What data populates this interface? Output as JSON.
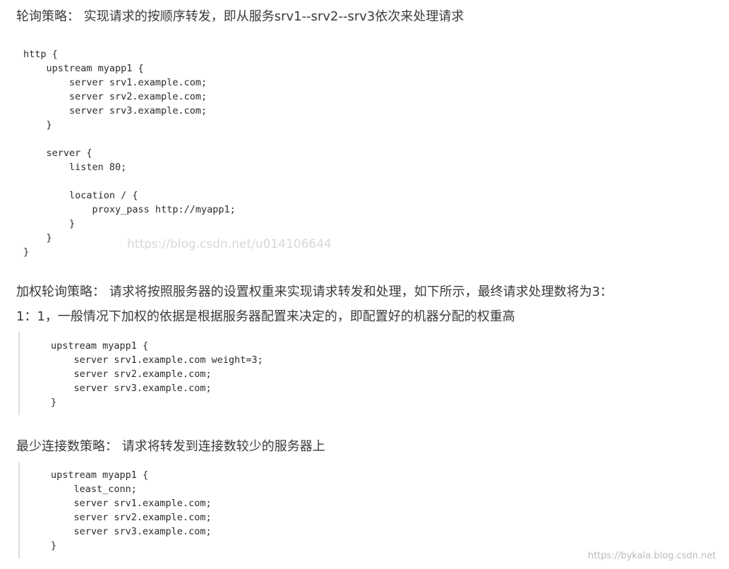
{
  "sections": [
    {
      "text": [
        "轮询策略： 实现请求的按顺序转发，即从服务srv1--srv2--srv3依次来处理请求"
      ],
      "code": [
        "http {",
        "    upstream myapp1 {",
        "        server srv1.example.com;",
        "        server srv2.example.com;",
        "        server srv3.example.com;",
        "    }",
        "",
        "    server {",
        "        listen 80;",
        "",
        "        location / {",
        "            proxy_pass http://myapp1;",
        "        }",
        "    }",
        "}"
      ]
    },
    {
      "text": [
        "加权轮询策略： 请求将按照服务器的设置权重来实现请求转发和处理，如下所示，最终请求处理数将为3：",
        "1：1，一般情况下加权的依据是根据服务器配置来决定的，即配置好的机器分配的权重高"
      ],
      "code": [
        "upstream myapp1 {",
        "    server srv1.example.com weight=3;",
        "    server srv2.example.com;",
        "    server srv3.example.com;",
        "}"
      ]
    },
    {
      "text": [
        "最少连接数策略： 请求将转发到连接数较少的服务器上"
      ],
      "code": [
        "upstream myapp1 {",
        "    least_conn;",
        "    server srv1.example.com;",
        "    server srv2.example.com;",
        "    server srv3.example.com;",
        "}"
      ]
    }
  ],
  "watermarks": [
    "https://blog.csdn.net/u014106644",
    "https://bykala.blog.csdn.net"
  ]
}
